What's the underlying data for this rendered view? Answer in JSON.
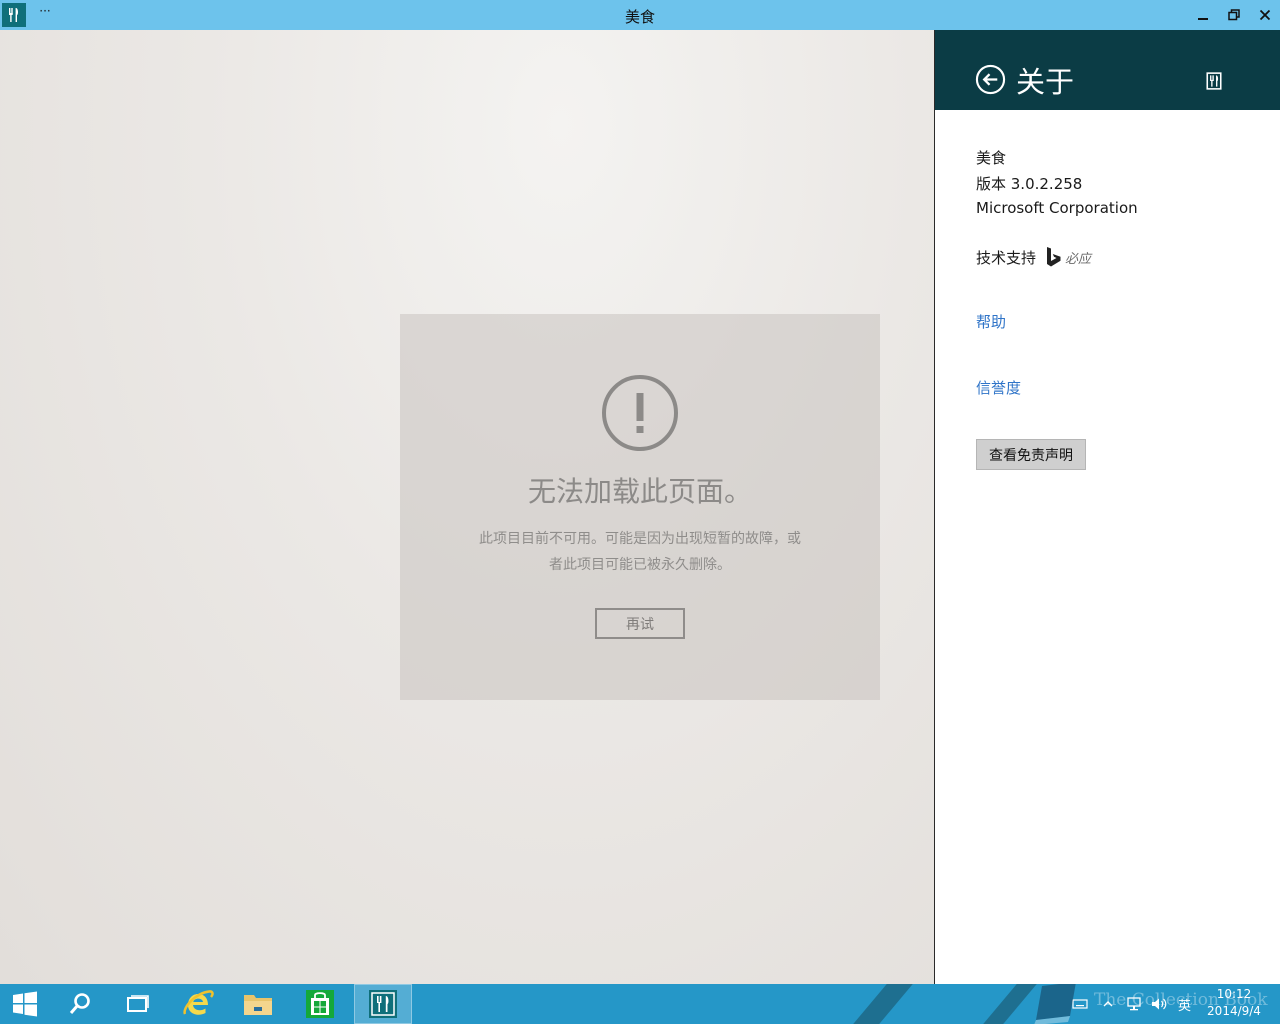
{
  "window": {
    "title": "美食",
    "menu_glyph": "···"
  },
  "error": {
    "title": "无法加载此页面。",
    "desc_line1": "此项目目前不可用。可能是因为出现短暂的故障，或",
    "desc_line2": "者此项目可能已被永久删除。",
    "retry_label": "再试"
  },
  "about": {
    "title": "关于",
    "app_name": "美食",
    "version": "版本 3.0.2.258",
    "publisher": "Microsoft Corporation",
    "support_label": "技术支持",
    "support_brand": "必应",
    "links": {
      "help": "帮助",
      "credits": "信誉度"
    },
    "disclaimer_label": "查看免责声明"
  },
  "taskbar": {
    "ime": "英",
    "time": "10:12",
    "date": "2014/9/4",
    "watermark": "The Collection Book"
  },
  "colors": {
    "titlebar": "#6dc3ec",
    "about_header": "#0b3c45",
    "link": "#2f74c8",
    "taskbar": "#2597c8",
    "app_tile": "#0f6f7a"
  }
}
